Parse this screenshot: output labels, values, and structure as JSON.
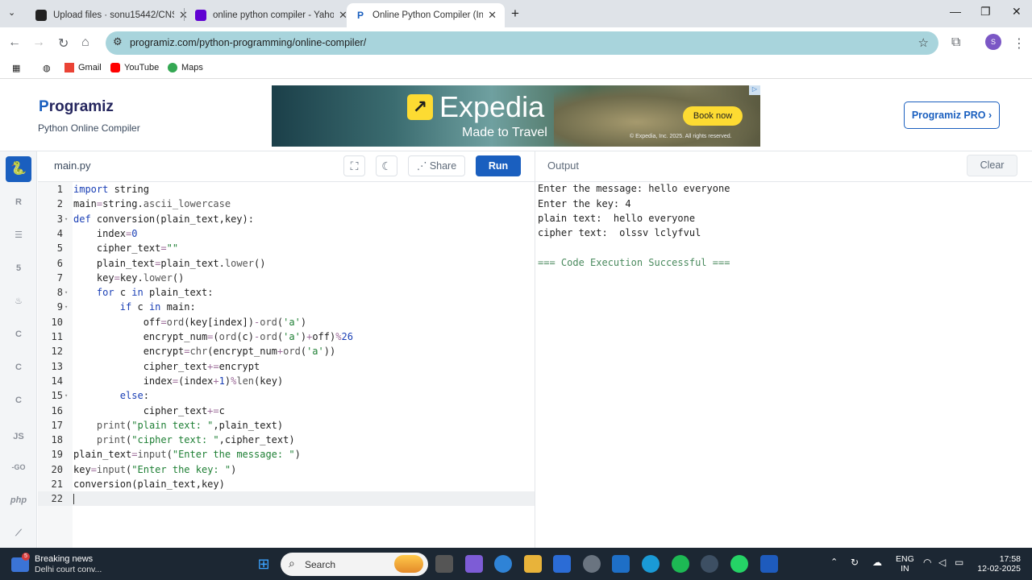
{
  "browser": {
    "tabs": [
      {
        "label": "Upload files · sonu15442/CNS",
        "favicon": "github-icon"
      },
      {
        "label": "online python compiler - Yahoo",
        "favicon": "yahoo-icon"
      },
      {
        "label": "Online Python Compiler (Interp",
        "favicon": "programiz-icon"
      }
    ],
    "new_tab": "+",
    "window_controls": {
      "minimize": "—",
      "maximize": "❐",
      "close": "✕"
    },
    "url": "programiz.com/python-programming/online-compiler/",
    "profile_initial": "S",
    "bookmarks": [
      "Gmail",
      "YouTube",
      "Maps"
    ]
  },
  "header": {
    "logo_mark": "P",
    "logo_text": "rogramiz",
    "subtitle": "Python Online Compiler",
    "pro_button": "Programiz PRO ›"
  },
  "ad": {
    "brand": "Expedia",
    "tagline": "Made to Travel",
    "cta": "Book now",
    "copyright": "© Expedia, Inc. 2025. All rights reserved.",
    "logo_glyph": "↗",
    "badge": "▷"
  },
  "rail": {
    "items": [
      {
        "name": "python",
        "label": "🐍"
      },
      {
        "name": "r",
        "label": "R"
      },
      {
        "name": "sql",
        "label": "☰"
      },
      {
        "name": "html",
        "label": "5"
      },
      {
        "name": "java",
        "label": "♨"
      },
      {
        "name": "c",
        "label": "C"
      },
      {
        "name": "cpp",
        "label": "C"
      },
      {
        "name": "csharp",
        "label": "C"
      },
      {
        "name": "js",
        "label": "JS"
      },
      {
        "name": "go",
        "label": "-GO"
      },
      {
        "name": "php",
        "label": "php"
      },
      {
        "name": "swift",
        "label": "⟋"
      }
    ]
  },
  "editor": {
    "filename": "main.py",
    "share": "Share",
    "run": "Run",
    "lines": [
      {
        "n": "1",
        "fold": "",
        "code": "import string"
      },
      {
        "n": "2",
        "fold": "",
        "code": "main=string.ascii_lowercase"
      },
      {
        "n": "3",
        "fold": "▾",
        "code": "def conversion(plain_text,key):"
      },
      {
        "n": "4",
        "fold": "",
        "code": "    index=0"
      },
      {
        "n": "5",
        "fold": "",
        "code": "    cipher_text=\"\""
      },
      {
        "n": "6",
        "fold": "",
        "code": "    plain_text=plain_text.lower()"
      },
      {
        "n": "7",
        "fold": "",
        "code": "    key=key.lower()"
      },
      {
        "n": "8",
        "fold": "▾",
        "code": "    for c in plain_text:"
      },
      {
        "n": "9",
        "fold": "▾",
        "code": "        if c in main:"
      },
      {
        "n": "10",
        "fold": "",
        "code": "            off=ord(key[index])-ord('a')"
      },
      {
        "n": "11",
        "fold": "",
        "code": "            encrypt_num=(ord(c)-ord('a')+off)%26"
      },
      {
        "n": "12",
        "fold": "",
        "code": "            encrypt=chr(encrypt_num+ord('a'))"
      },
      {
        "n": "13",
        "fold": "",
        "code": "            cipher_text+=encrypt"
      },
      {
        "n": "14",
        "fold": "",
        "code": "            index=(index+1)%len(key)"
      },
      {
        "n": "15",
        "fold": "▾",
        "code": "        else:"
      },
      {
        "n": "16",
        "fold": "",
        "code": "            cipher_text+=c"
      },
      {
        "n": "17",
        "fold": "",
        "code": "    print(\"plain text: \",plain_text)"
      },
      {
        "n": "18",
        "fold": "",
        "code": "    print(\"cipher text: \",cipher_text)"
      },
      {
        "n": "19",
        "fold": "",
        "code": "plain_text=input(\"Enter the message: \")"
      },
      {
        "n": "20",
        "fold": "",
        "code": "key=input(\"Enter the key: \")"
      },
      {
        "n": "21",
        "fold": "",
        "code": "conversion(plain_text,key)"
      },
      {
        "n": "22",
        "fold": "",
        "code": ""
      }
    ]
  },
  "output": {
    "title": "Output",
    "clear": "Clear",
    "lines": [
      "Enter the message: hello everyone",
      "Enter the key: 4",
      "plain text:  hello everyone",
      "cipher text:  olssv lclyfvul",
      "",
      "=== Code Execution Successful ==="
    ]
  },
  "taskbar": {
    "news_badge": "5",
    "news_title": "Breaking news",
    "news_sub": "Delhi court conv...",
    "search": "Search",
    "lang": "ENG",
    "region": "IN",
    "time": "17:58",
    "date": "12-02-2025"
  },
  "colors": {
    "accent": "#1a5fbf",
    "run": "#1a5fbf",
    "omnibox": "#a8d4dc",
    "ad_yellow": "#fddb32"
  }
}
